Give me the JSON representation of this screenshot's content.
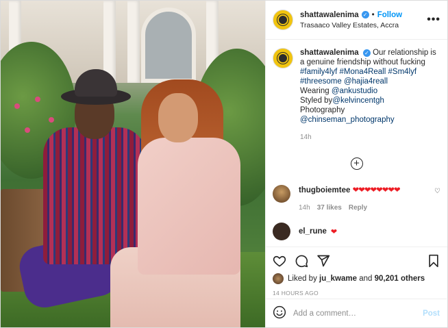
{
  "header": {
    "username": "shattawalenima",
    "follow_label": "Follow",
    "location": "Trasaaco Valley Estates, Accra"
  },
  "caption": {
    "username": "shattawalenima",
    "text": "Our relationship is a genuine friendship without fucking",
    "hashtags": [
      "#family4lyf",
      "#Mona4Reall",
      "#Sm4lyf",
      "#threesome"
    ],
    "mention_main": "@hajia4reall",
    "wearing_label": "Wearing",
    "wearing_mention": "@ankustudio",
    "styled_label": "Styled by",
    "styled_mention": "@kelvincentgh",
    "photography_label": "Photography",
    "photography_mention": "@chinseman_photography",
    "time": "14h"
  },
  "comments": [
    {
      "username": "thugboiemtee",
      "text": "❤❤❤❤❤❤❤❤",
      "time": "14h",
      "likes": "37 likes",
      "reply_label": "Reply"
    },
    {
      "username": "el_rune",
      "text": "❤"
    }
  ],
  "actions": {
    "liked_by_prefix": "Liked by",
    "liked_by_user": "ju_kwame",
    "liked_by_and": "and",
    "liked_by_others": "90,201 others",
    "timestamp": "14 HOURS AGO"
  },
  "comment_box": {
    "placeholder": "Add a comment…",
    "post_label": "Post"
  },
  "colors": {
    "link": "#00376b",
    "follow": "#0095f6",
    "post_disabled": "#b2dffc",
    "heart": "#ed1c24"
  }
}
